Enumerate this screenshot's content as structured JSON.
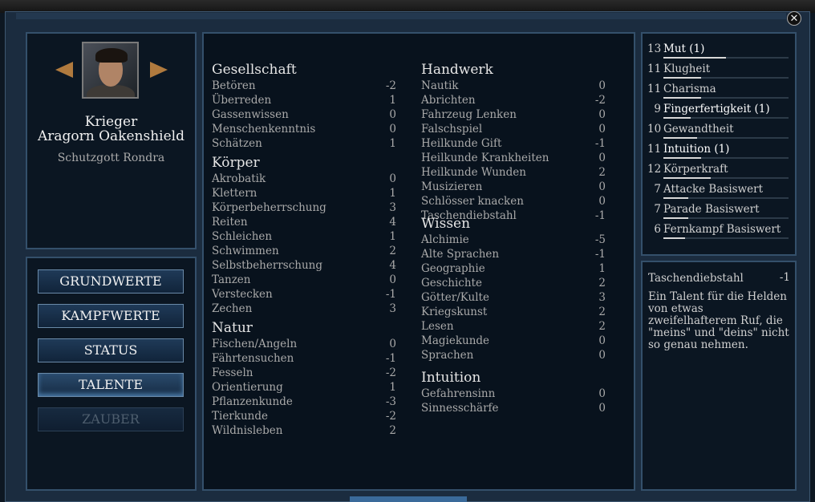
{
  "window": {
    "close_glyph": "✕"
  },
  "character": {
    "class": "Krieger",
    "name": "Aragorn Oakenshield",
    "deity": "Schutzgott Rondra"
  },
  "nav": {
    "buttons": [
      {
        "label": "GRUNDWERTE",
        "state": "normal"
      },
      {
        "label": "KAMPFWERTE",
        "state": "normal"
      },
      {
        "label": "STATUS",
        "state": "normal"
      },
      {
        "label": "TALENTE",
        "state": "active"
      },
      {
        "label": "ZAUBER",
        "state": "disabled"
      }
    ]
  },
  "talents": {
    "left": [
      {
        "title": "Gesellschaft",
        "items": [
          {
            "name": "Betören",
            "value": "-2"
          },
          {
            "name": "Überreden",
            "value": "1"
          },
          {
            "name": "Gassenwissen",
            "value": "0"
          },
          {
            "name": "Menschenkenntnis",
            "value": "0"
          },
          {
            "name": "Schätzen",
            "value": "1"
          }
        ]
      },
      {
        "title": "Körper",
        "items": [
          {
            "name": "Akrobatik",
            "value": "0"
          },
          {
            "name": "Klettern",
            "value": "1"
          },
          {
            "name": "Körperbeherrschung",
            "value": "3"
          },
          {
            "name": "Reiten",
            "value": "4"
          },
          {
            "name": "Schleichen",
            "value": "1"
          },
          {
            "name": "Schwimmen",
            "value": "2"
          },
          {
            "name": "Selbstbeherrschung",
            "value": "4"
          },
          {
            "name": "Tanzen",
            "value": "0"
          },
          {
            "name": "Verstecken",
            "value": "-1"
          },
          {
            "name": "Zechen",
            "value": "3"
          }
        ]
      },
      {
        "title": "Natur",
        "items": [
          {
            "name": "Fischen/Angeln",
            "value": "0"
          },
          {
            "name": "Fährtensuchen",
            "value": "-1"
          },
          {
            "name": "Fesseln",
            "value": "-2"
          },
          {
            "name": "Orientierung",
            "value": "1"
          },
          {
            "name": "Pflanzenkunde",
            "value": "-3"
          },
          {
            "name": "Tierkunde",
            "value": "-2"
          },
          {
            "name": "Wildnisleben",
            "value": "2"
          }
        ]
      }
    ],
    "right": [
      {
        "title": "Handwerk",
        "items": [
          {
            "name": "Nautik",
            "value": "0"
          },
          {
            "name": "Abrichten",
            "value": "-2"
          },
          {
            "name": "Fahrzeug Lenken",
            "value": "0"
          },
          {
            "name": "Falschspiel",
            "value": "0"
          },
          {
            "name": "Heilkunde Gift",
            "value": "-1"
          },
          {
            "name": "Heilkunde Krankheiten",
            "value": "0"
          },
          {
            "name": "Heilkunde Wunden",
            "value": "2"
          },
          {
            "name": "Musizieren",
            "value": "0"
          },
          {
            "name": "Schlösser knacken",
            "value": "0"
          },
          {
            "name": "Taschendiebstahl",
            "value": "-1"
          }
        ]
      },
      {
        "title": "Wissen",
        "items": [
          {
            "name": "Alchimie",
            "value": "-5"
          },
          {
            "name": "Alte Sprachen",
            "value": "-1"
          },
          {
            "name": "Geographie",
            "value": "1"
          },
          {
            "name": "Geschichte",
            "value": "2"
          },
          {
            "name": "Götter/Kulte",
            "value": "3"
          },
          {
            "name": "Kriegskunst",
            "value": "2"
          },
          {
            "name": "Lesen",
            "value": "2"
          },
          {
            "name": "Magiekunde",
            "value": "0"
          },
          {
            "name": "Sprachen",
            "value": "0"
          }
        ]
      },
      {
        "title": "Intuition",
        "items": [
          {
            "name": "Gefahrensinn",
            "value": "0"
          },
          {
            "name": "Sinnesschärfe",
            "value": "0"
          }
        ]
      }
    ]
  },
  "attributes": [
    {
      "value": "13",
      "name": "Mut (1)",
      "highlight": true,
      "level": 0.5
    },
    {
      "value": "11",
      "name": "Klugheit",
      "highlight": false,
      "level": 0.3
    },
    {
      "value": "11",
      "name": "Charisma",
      "highlight": false,
      "level": 0.3
    },
    {
      "value": "9",
      "name": "Fingerfertigkeit (1)",
      "highlight": true,
      "level": 0.22
    },
    {
      "value": "10",
      "name": "Gewandtheit",
      "highlight": false,
      "level": 0.27
    },
    {
      "value": "11",
      "name": "Intuition (1)",
      "highlight": true,
      "level": 0.3
    },
    {
      "value": "12",
      "name": "Körperkraft",
      "highlight": false,
      "level": 0.38
    },
    {
      "value": "7",
      "name": "Attacke Basiswert",
      "highlight": false,
      "level": 0.2
    },
    {
      "value": "7",
      "name": "Parade Basiswert",
      "highlight": false,
      "level": 0.2
    },
    {
      "value": "6",
      "name": "Fernkampf Basiswert",
      "highlight": false,
      "level": 0.17
    }
  ],
  "description": {
    "title": "Taschendiebstahl",
    "value": "-1",
    "text": "Ein Talent für die Helden von etwas zweifelhafterem Ruf, die \"meins\" und \"deins\" nicht so genau nehmen."
  }
}
